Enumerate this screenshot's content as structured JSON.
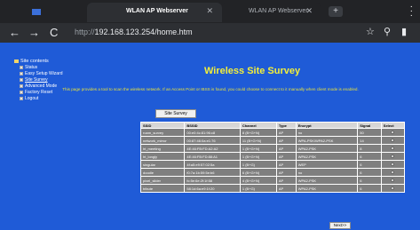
{
  "browser": {
    "left_tab_label": "",
    "tabs": [
      {
        "title": "WLAN AP Webserver",
        "active": true
      },
      {
        "title": "WLAN AP Webserver",
        "active": false
      }
    ],
    "url_protocol": "http://",
    "url_rest": "192.168.123.254/home.htm",
    "colors": {
      "tabbar": "#222326",
      "addrbar": "#2d2f33"
    }
  },
  "sidebar": {
    "heading": "Site contents",
    "items": [
      {
        "label": "Status",
        "link": false
      },
      {
        "label": "Easy Setup Wizard",
        "link": false
      },
      {
        "label": "Site Survey",
        "link": true
      },
      {
        "label": "Advanced Mode",
        "link": false
      },
      {
        "label": "Factory Reset",
        "link": false
      },
      {
        "label": "Logout",
        "link": false
      }
    ]
  },
  "main": {
    "title": "Wireless Site Survey",
    "description": "This page provides a tool to scan the wireless network. If an Access Point or IBSS is found, you could choose to connect to it manually when client mode is enabled.",
    "survey_button": "Site Survey",
    "next_button": "Next>>",
    "table": {
      "headers": [
        "SSID",
        "BSSID",
        "Channel",
        "Type",
        "Encrypt",
        "Signal",
        "Select"
      ],
      "rows": [
        [
          "roam_survey",
          "00:e0:4c:81:96:c8",
          "8 (B+G+N)",
          "AP",
          "no",
          "50",
          ""
        ],
        [
          "network_mirror",
          "00:87:46:0a:e1:76",
          "11 (B+G+N)",
          "AP",
          "WPA-PSK/WPA2-PSK",
          "14",
          ""
        ],
        [
          "ht_meeting",
          "4E:46:FB:FD:A2:A2",
          "1 (B+G+N)",
          "AP",
          "WPA2-PSK",
          "8",
          ""
        ],
        [
          "ht_longly",
          "4E:46:FB:FD:88:A1",
          "1 (B+G+N)",
          "AP",
          "WPA2-PSK",
          "6",
          ""
        ],
        [
          "singular",
          "4f:a5:e9:57:02:5a",
          "1 (B+G)",
          "AP",
          "WEP",
          "6",
          ""
        ],
        [
          "doodle",
          "f0:7a:1b:59:5e:b6",
          "6 (B+G+N)",
          "AP",
          "no",
          "6",
          ""
        ],
        [
          "pixel_slider",
          "fc:5e:6e:2f:1f:58",
          "4 (B+G+N)",
          "AP",
          "WPA2-PSK",
          "6",
          ""
        ],
        [
          "tribute",
          "58:1d:6a:e9:1f:20",
          "1 (B+G)",
          "AP",
          "WPA2-PSK",
          "6",
          ""
        ]
      ]
    }
  },
  "colors": {
    "page_bg": "#1f5bd7",
    "title": "#f3ef3a",
    "table_cell": "#7f7f7f",
    "table_header": "#d6d6d6"
  }
}
